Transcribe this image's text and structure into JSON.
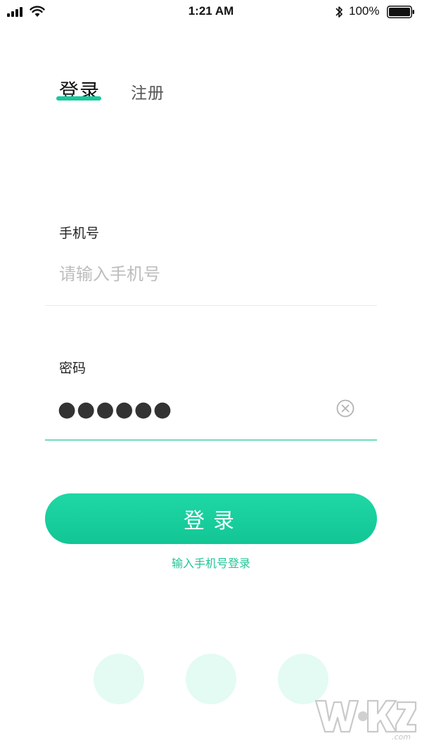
{
  "status_bar": {
    "time": "1:21 AM",
    "battery_percent": "100%",
    "icons": [
      "signal-icon",
      "wifi-icon",
      "bluetooth-icon",
      "battery-icon"
    ]
  },
  "tabs": {
    "login": "登录",
    "register": "注册",
    "active": "login"
  },
  "form": {
    "phone_label": "手机号",
    "phone_placeholder": "请输入手机号",
    "phone_value": "",
    "password_label": "密码",
    "password_mask": "●●●●●●"
  },
  "actions": {
    "login_button": "登录",
    "sms_login_link": "输入手机号登录"
  },
  "social": {
    "count": 3
  },
  "colors": {
    "accent": "#19c99b",
    "button_gradient_top": "#1fd7a6",
    "button_gradient_bottom": "#12c694",
    "circle_fill": "#e3fbf3",
    "placeholder": "#bdbdbd"
  }
}
